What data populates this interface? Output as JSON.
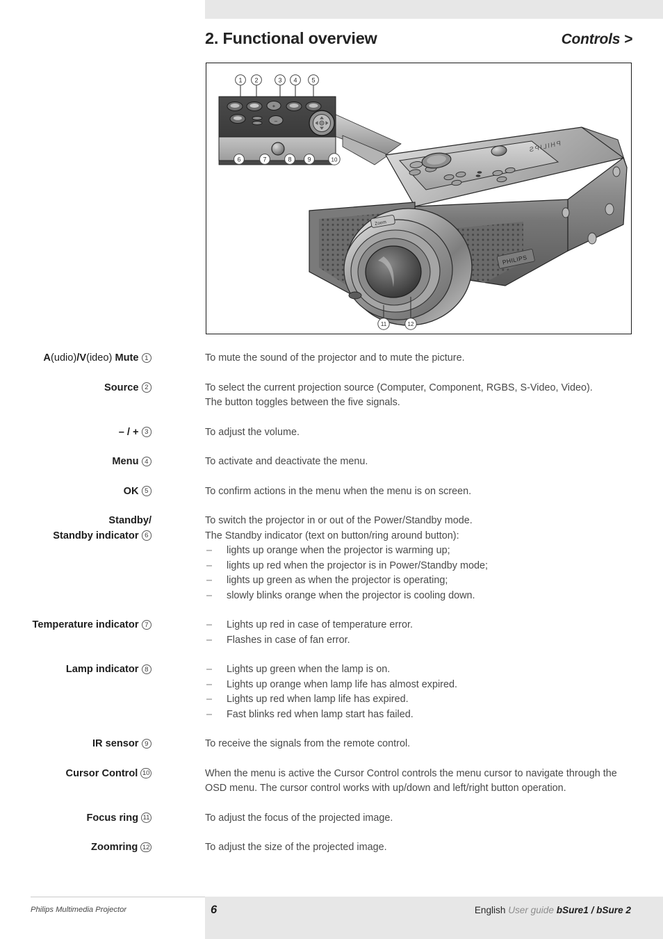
{
  "header": {
    "chapter_title": "2. Functional overview",
    "section_title": "Controls >"
  },
  "figure": {
    "name": "projector-controls-diagram",
    "alt": "Philips bSure projector shown from the front-right with an enlarged inset of the top control panel",
    "callouts": [
      "1",
      "2",
      "3",
      "4",
      "5",
      "6",
      "7",
      "8",
      "9",
      "10",
      "11",
      "12"
    ],
    "brand_top": "PHILIPS",
    "brand_side": "PHILIPS",
    "zoom_label": "Zoom",
    "panel_key_labels": [
      "+",
      "-"
    ]
  },
  "specs": [
    {
      "id": "av-mute",
      "term_lines": [
        [
          {
            "text": "A",
            "bold": true
          },
          {
            "text": "(udio)",
            "bold": false
          },
          {
            "text": "/V",
            "bold": true
          },
          {
            "text": "(ideo)",
            "bold": false
          },
          {
            "text": " Mute",
            "bold": true
          }
        ]
      ],
      "callout": "1",
      "paragraphs": [
        "To mute the sound of the projector and to mute the picture."
      ],
      "bullets": []
    },
    {
      "id": "source",
      "term_lines": [
        [
          {
            "text": "Source",
            "bold": true
          }
        ]
      ],
      "callout": "2",
      "paragraphs": [
        "To select the current projection source (Computer, Component, RGBS, S-Video, Video).",
        "The button toggles between the five signals."
      ],
      "bullets": []
    },
    {
      "id": "volume",
      "term_lines": [
        [
          {
            "text": "– / +",
            "bold": true
          }
        ]
      ],
      "callout": "3",
      "paragraphs": [
        "To adjust the volume."
      ],
      "bullets": []
    },
    {
      "id": "menu",
      "term_lines": [
        [
          {
            "text": "Menu",
            "bold": true
          }
        ]
      ],
      "callout": "4",
      "paragraphs": [
        "To activate and deactivate the menu."
      ],
      "bullets": []
    },
    {
      "id": "ok",
      "term_lines": [
        [
          {
            "text": "OK",
            "bold": true
          }
        ]
      ],
      "callout": "5",
      "paragraphs": [
        "To confirm actions in the menu when the menu is on screen."
      ],
      "bullets": []
    },
    {
      "id": "standby",
      "term_lines": [
        [
          {
            "text": "Standby/",
            "bold": true
          }
        ],
        [
          {
            "text": "Standby indicator",
            "bold": true
          }
        ]
      ],
      "callout": "6",
      "paragraphs": [
        "To switch the projector in or out of the Power/Standby mode.",
        "The Standby indicator (text on button/ring around button):"
      ],
      "bullets": [
        "lights up orange when the projector is warming up;",
        "lights up red when the projector is in Power/Standby mode;",
        "lights up green as when the projector is operating;",
        "slowly blinks orange when the projector is cooling down."
      ]
    },
    {
      "id": "temperature-indicator",
      "term_lines": [
        [
          {
            "text": "Temperature indicator",
            "bold": true
          }
        ]
      ],
      "callout": "7",
      "paragraphs": [],
      "bullets": [
        "Lights up red in case of temperature error.",
        "Flashes in case of fan error."
      ]
    },
    {
      "id": "lamp-indicator",
      "term_lines": [
        [
          {
            "text": "Lamp indicator",
            "bold": true
          }
        ]
      ],
      "callout": "8",
      "paragraphs": [],
      "bullets": [
        "Lights up green when the lamp is on.",
        "Lights up orange when lamp life has almost expired.",
        "Lights up red when lamp life has expired.",
        "Fast blinks red when lamp start has failed."
      ]
    },
    {
      "id": "ir-sensor",
      "term_lines": [
        [
          {
            "text": "IR sensor",
            "bold": true
          }
        ]
      ],
      "callout": "9",
      "paragraphs": [
        "To receive the signals from the remote control."
      ],
      "bullets": []
    },
    {
      "id": "cursor-control",
      "term_lines": [
        [
          {
            "text": "Cursor Control",
            "bold": true
          }
        ]
      ],
      "callout": "10",
      "paragraphs": [
        "When the menu is active the Cursor Control controls the menu cursor to navigate through the",
        "OSD menu. The cursor control works with up/down and left/right button operation."
      ],
      "bullets": []
    },
    {
      "id": "focus-ring",
      "term_lines": [
        [
          {
            "text": "Focus ring",
            "bold": true
          }
        ]
      ],
      "callout": "11",
      "paragraphs": [
        "To adjust the focus of the projected image."
      ],
      "bullets": []
    },
    {
      "id": "zoomring",
      "term_lines": [
        [
          {
            "text": "Zoomring",
            "bold": true
          }
        ]
      ],
      "callout": "12",
      "paragraphs": [
        "To adjust the size of the projected image."
      ],
      "bullets": []
    }
  ],
  "footer": {
    "left": "Philips Multimedia Projector",
    "page_number": "6",
    "language": "English",
    "guide": "User guide",
    "model": "bSure1 / bSure 2"
  }
}
